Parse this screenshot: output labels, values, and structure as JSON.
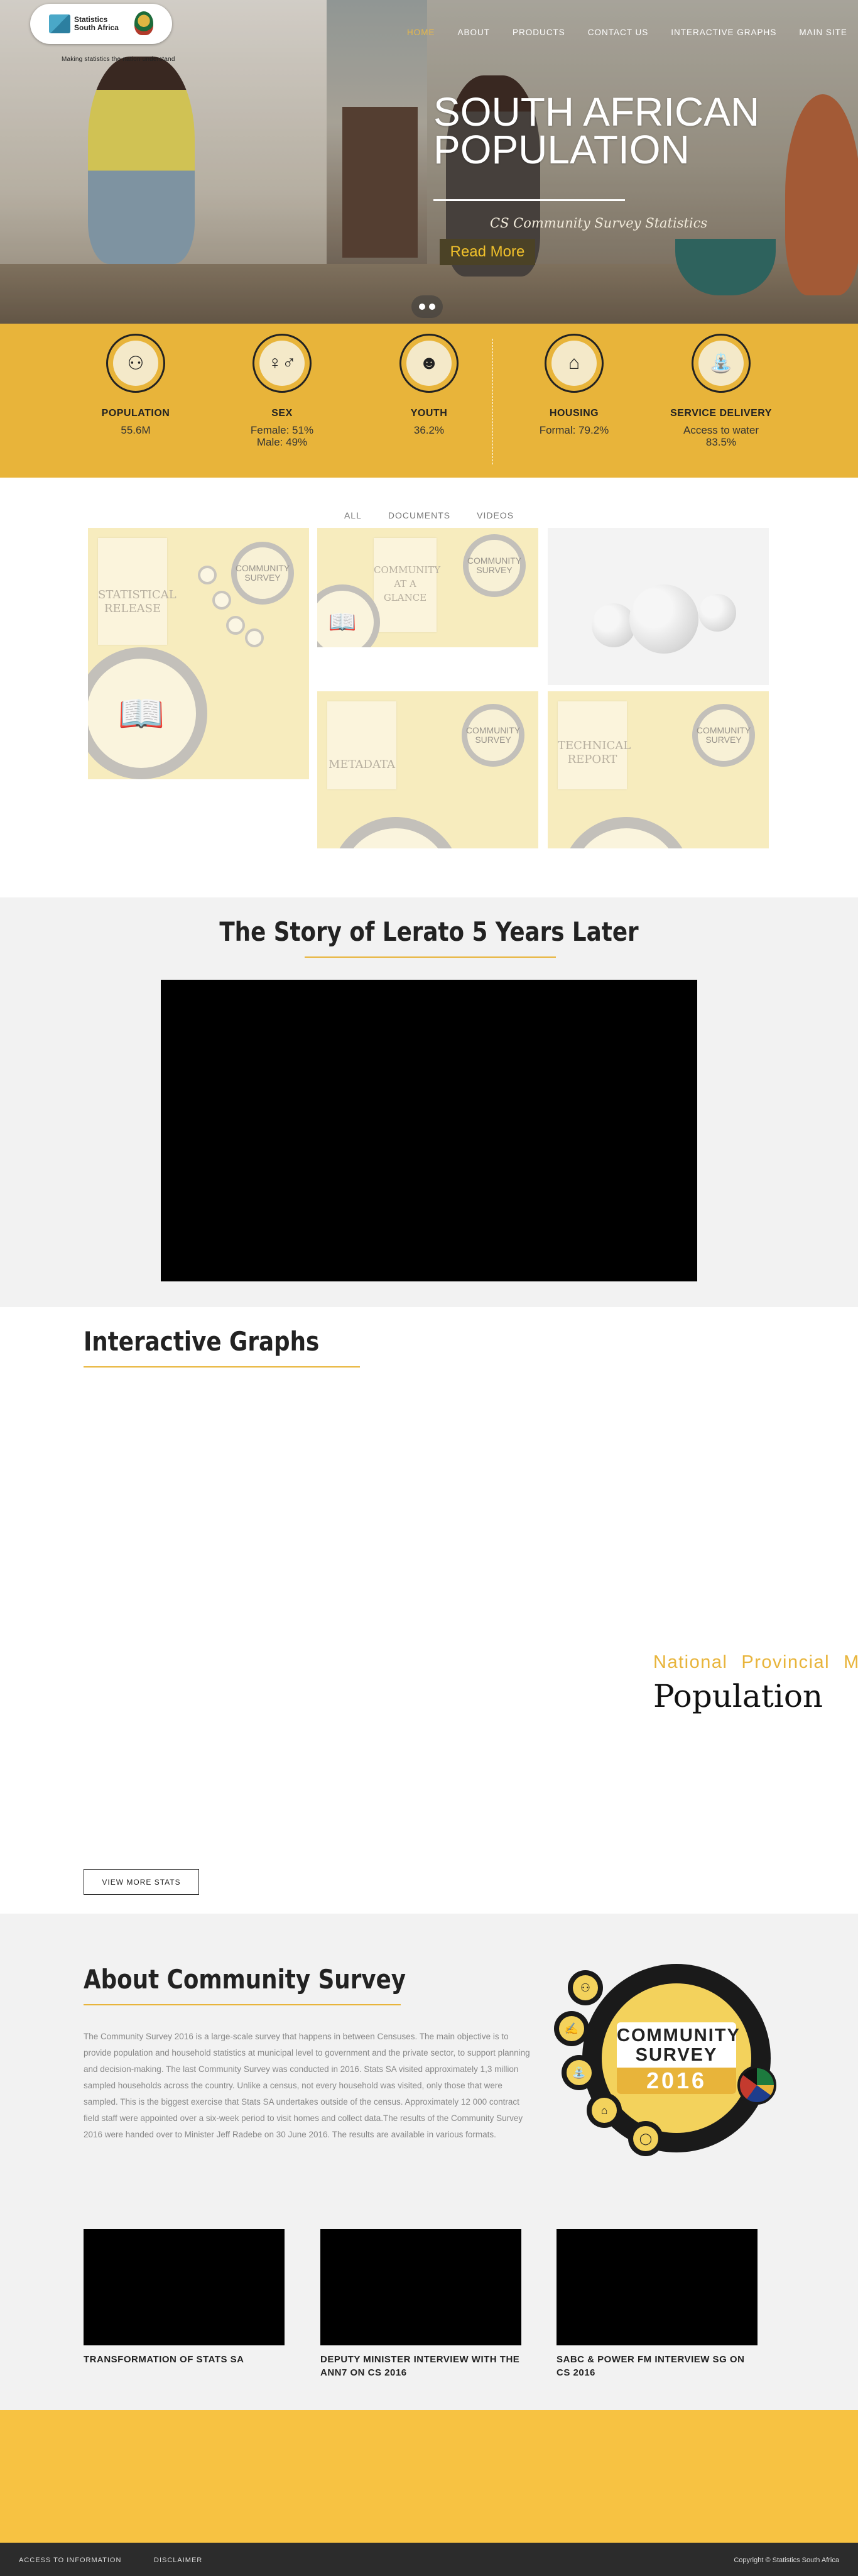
{
  "brand": {
    "name_line1": "Statistics",
    "name_line2": "South Africa",
    "tagline": "Making statistics the nation understand"
  },
  "nav": {
    "items": [
      "HOME",
      "ABOUT",
      "PRODUCTS",
      "CONTACT US",
      "INTERACTIVE GRAPHS",
      "MAIN SITE"
    ],
    "active": "HOME"
  },
  "hero": {
    "title_line1": "SOUTH AFRICAN",
    "title_line2": "POPULATION",
    "subtitle": "CS Community Survey Statistics",
    "button": "Read More"
  },
  "stats": [
    {
      "label": "POPULATION",
      "value": "55.6M",
      "icon": "population-icon"
    },
    {
      "label": "SEX",
      "value": "Female: 51%",
      "value2": "Male: 49%",
      "icon": "sex-icon"
    },
    {
      "label": "YOUTH",
      "value": "36.2%",
      "icon": "youth-icon"
    },
    {
      "label": "HOUSING",
      "value": "Formal: 79.2%",
      "icon": "housing-icon"
    },
    {
      "label": "SERVICE DELIVERY",
      "value": "Access to water",
      "value2": "83.5%",
      "icon": "water-tap-icon"
    }
  ],
  "filters": [
    "ALL",
    "DOCUMENTS",
    "VIDEOS"
  ],
  "gallery": {
    "tiles": [
      {
        "doc_line1": "STATISTICAL",
        "doc_line2": "RELEASE",
        "seal_line1": "COMMUNITY",
        "seal_line2": "SURVEY"
      },
      {
        "doc_line1": "COMMUNITY",
        "doc_line2": "AT A GLANCE",
        "seal_line1": "COMMUNITY",
        "seal_line2": "SURVEY"
      },
      {},
      {
        "doc_line1": "METADATA",
        "doc_line2": "",
        "seal_line1": "COMMUNITY",
        "seal_line2": "SURVEY"
      },
      {
        "doc_line1": "TECHNICAL",
        "doc_line2": "REPORT",
        "seal_line1": "COMMUNITY",
        "seal_line2": "SURVEY"
      }
    ]
  },
  "story": {
    "title": "The Story of Lerato 5 Years Later"
  },
  "graphs": {
    "title": "Interactive Graphs",
    "tabs": [
      "National",
      "Provincial",
      "Mun"
    ],
    "metric": "Population",
    "button": "VIEW MORE STATS"
  },
  "about": {
    "title": "About Community Survey",
    "text": "The Community Survey 2016 is a large-scale survey that happens in between Censuses. The main objective is to provide population and household statistics at municipal level to government and the private sector, to support planning and decision-making. The last Community Survey was conducted in 2016. Stats SA visited approximately 1,3 million sampled households across the country. Unlike a census, not every household was visited, only those that were sampled. This is the biggest exercise that Stats SA undertakes outside of the census. Approximately 12 000 contract field staff were appointed over a six-week period to visit homes and collect data.The results of the Community Survey 2016 were handed over to Minister Jeff Radebe on 30 June 2016. The results are available in various formats.",
    "badge_line1": "COMMUNITY",
    "badge_line2": "SURVEY",
    "badge_year": "2016"
  },
  "videos": [
    {
      "caption": "TRANSFORMATION OF STATS SA"
    },
    {
      "caption": "DEPUTY MINISTER INTERVIEW WITH THE ANN7 ON CS 2016"
    },
    {
      "caption": "SABC & POWER FM INTERVIEW SG ON CS 2016"
    }
  ],
  "footer": {
    "links": [
      "ACCESS TO INFORMATION",
      "DISCLAIMER"
    ],
    "copyright": "Copyright © Statistics South Africa"
  },
  "colors": {
    "accent": "#e8b43a",
    "footer_band": "#f7c242",
    "footer": "#2c2c2c"
  }
}
